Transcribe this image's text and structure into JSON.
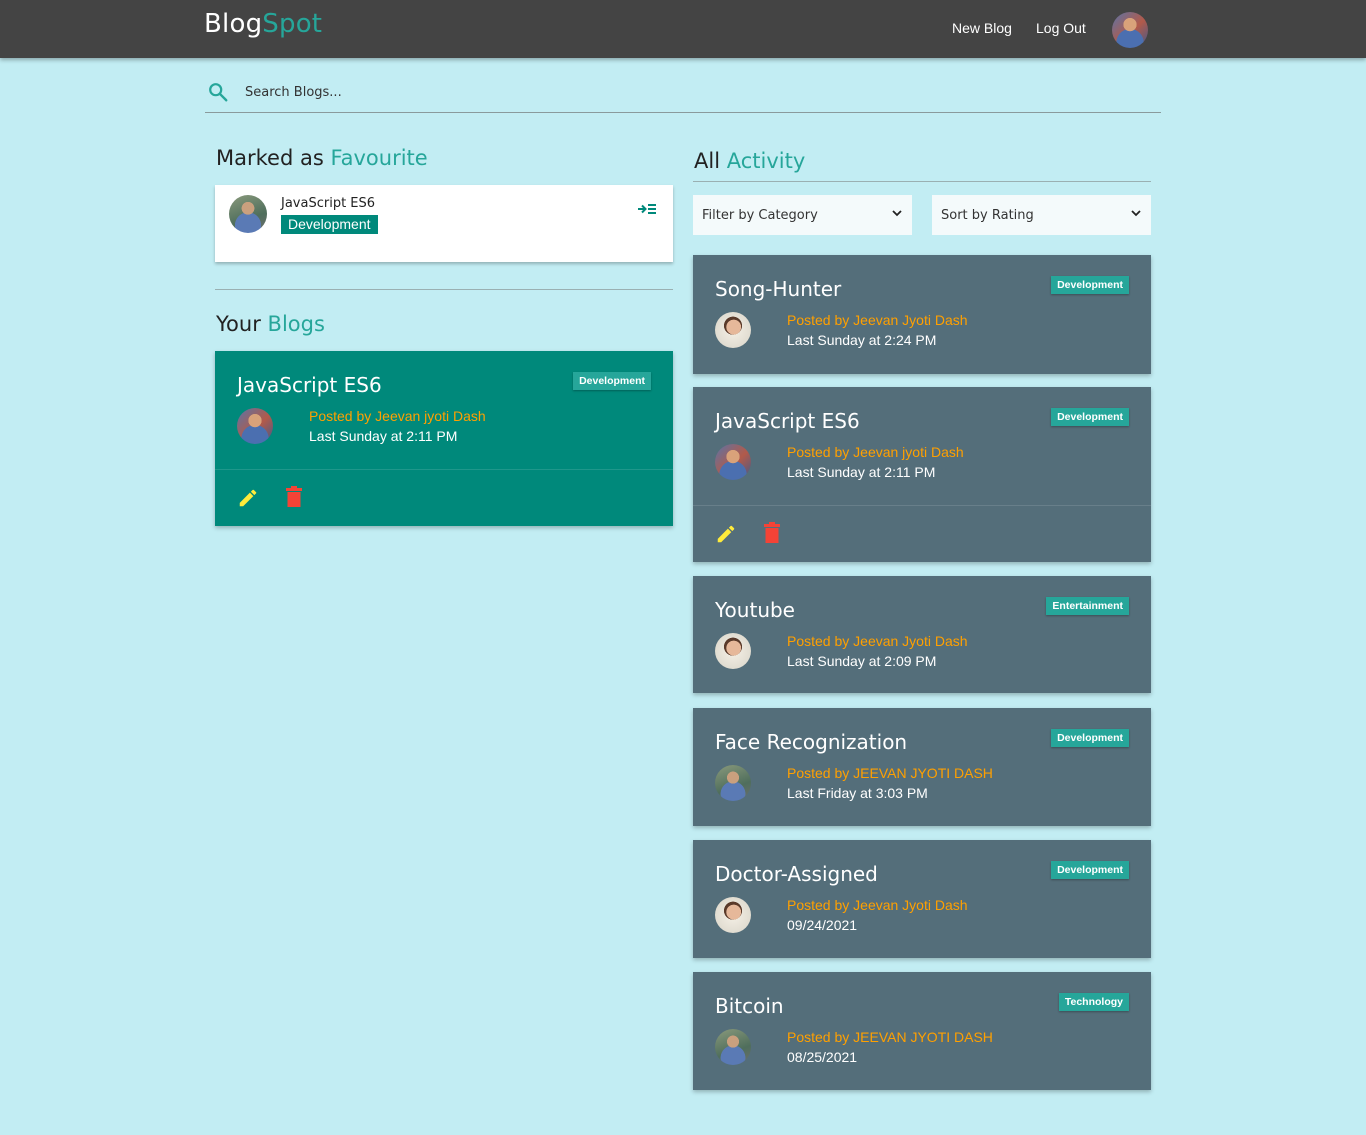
{
  "navbar": {
    "brand_part1": "Blog",
    "brand_part2": "Spot",
    "new_blog": "New Blog",
    "log_out": "Log Out"
  },
  "search": {
    "placeholder": "Search Blogs..."
  },
  "favourites": {
    "heading_prefix": "Marked as",
    "heading_accent": "Favourite",
    "items": [
      {
        "title": "JavaScript ES6",
        "category": "Development"
      }
    ]
  },
  "your_blogs": {
    "heading_prefix": "Your",
    "heading_accent": "Blogs",
    "items": [
      {
        "title": "JavaScript ES6",
        "category": "Development",
        "posted_by": "Posted by Jeevan jyoti Dash",
        "time": "Last Sunday at 2:11 PM"
      }
    ]
  },
  "all_activity": {
    "heading_prefix": "All",
    "heading_accent": "Activity",
    "filter_label": "Filter by Category",
    "sort_label": "Sort by Rating",
    "items": [
      {
        "title": "Song-Hunter",
        "category": "Development",
        "posted_by": "Posted by Jeevan Jyoti Dash",
        "time": "Last Sunday at 2:24 PM"
      },
      {
        "title": "JavaScript ES6",
        "category": "Development",
        "posted_by": "Posted by Jeevan jyoti Dash",
        "time": "Last Sunday at 2:11 PM"
      },
      {
        "title": "Youtube",
        "category": "Entertainment",
        "posted_by": "Posted by Jeevan Jyoti Dash",
        "time": "Last Sunday at 2:09 PM"
      },
      {
        "title": "Face Recognization",
        "category": "Development",
        "posted_by": "Posted by JEEVAN JYOTI DASH",
        "time": "Last Friday at 3:03 PM"
      },
      {
        "title": "Doctor-Assigned",
        "category": "Development",
        "posted_by": "Posted by Jeevan Jyoti Dash",
        "time": "09/24/2021"
      },
      {
        "title": "Bitcoin",
        "category": "Technology",
        "posted_by": "Posted by JEEVAN JYOTI DASH",
        "time": "08/25/2021"
      }
    ]
  },
  "icons": {
    "search": "search-icon",
    "remove_favourite": "playlist-remove-icon",
    "edit": "pencil-icon",
    "delete": "trash-icon",
    "dropdown": "chevron-down-icon"
  },
  "colors": {
    "page_bg": "#c2edf3",
    "navbar": "#444444",
    "accent": "#26a69a",
    "own_card": "#00897b",
    "activity_card": "#546e7a",
    "author": "#ffa000",
    "edit": "#ffeb3b",
    "delete": "#f44336"
  }
}
